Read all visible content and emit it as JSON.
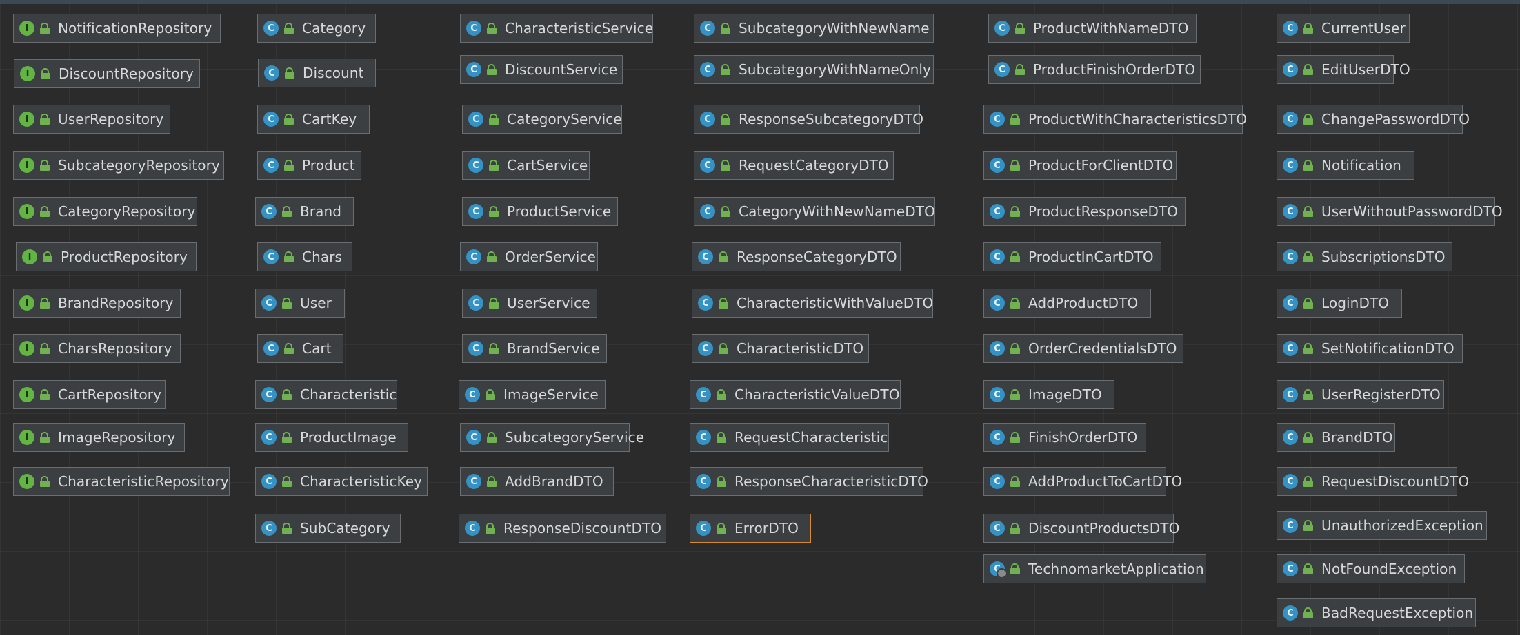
{
  "kind_letters": {
    "interface": "I",
    "class": "C"
  },
  "columns": [
    {
      "nodes": [
        {
          "label": "NotificationRepository",
          "kind": "interface"
        },
        {
          "label": "DiscountRepository",
          "kind": "interface"
        },
        {
          "label": "UserRepository",
          "kind": "interface"
        },
        {
          "label": "SubcategoryRepository",
          "kind": "interface"
        },
        {
          "label": "CategoryRepository",
          "kind": "interface"
        },
        {
          "label": "ProductRepository",
          "kind": "interface"
        },
        {
          "label": "BrandRepository",
          "kind": "interface"
        },
        {
          "label": "CharsRepository",
          "kind": "interface"
        },
        {
          "label": "CartRepository",
          "kind": "interface"
        },
        {
          "label": "ImageRepository",
          "kind": "interface"
        },
        {
          "label": "CharacteristicRepository",
          "kind": "interface"
        }
      ]
    },
    {
      "nodes": [
        {
          "label": "Category",
          "kind": "class"
        },
        {
          "label": "Discount",
          "kind": "class"
        },
        {
          "label": "CartKey",
          "kind": "class"
        },
        {
          "label": "Product",
          "kind": "class"
        },
        {
          "label": "Brand",
          "kind": "class"
        },
        {
          "label": "Chars",
          "kind": "class"
        },
        {
          "label": "User",
          "kind": "class"
        },
        {
          "label": "Cart",
          "kind": "class"
        },
        {
          "label": "Characteristic",
          "kind": "class"
        },
        {
          "label": "ProductImage",
          "kind": "class"
        },
        {
          "label": "CharacteristicKey",
          "kind": "class"
        },
        {
          "label": "SubCategory",
          "kind": "class"
        }
      ]
    },
    {
      "nodes": [
        {
          "label": "CharacteristicService",
          "kind": "class"
        },
        {
          "label": "DiscountService",
          "kind": "class"
        },
        {
          "label": "CategoryService",
          "kind": "class"
        },
        {
          "label": "CartService",
          "kind": "class"
        },
        {
          "label": "ProductService",
          "kind": "class"
        },
        {
          "label": "OrderService",
          "kind": "class"
        },
        {
          "label": "UserService",
          "kind": "class"
        },
        {
          "label": "BrandService",
          "kind": "class"
        },
        {
          "label": "ImageService",
          "kind": "class"
        },
        {
          "label": "SubcategoryService",
          "kind": "class"
        },
        {
          "label": "AddBrandDTO",
          "kind": "class"
        },
        {
          "label": "ResponseDiscountDTO",
          "kind": "class"
        }
      ]
    },
    {
      "nodes": [
        {
          "label": "SubcategoryWithNewName",
          "kind": "class"
        },
        {
          "label": "SubcategoryWithNameOnly",
          "kind": "class"
        },
        {
          "label": "ResponseSubcategoryDTO",
          "kind": "class"
        },
        {
          "label": "RequestCategoryDTO",
          "kind": "class"
        },
        {
          "label": "CategoryWithNewNameDTO",
          "kind": "class"
        },
        {
          "label": "ResponseCategoryDTO",
          "kind": "class"
        },
        {
          "label": "CharacteristicWithValueDTO",
          "kind": "class"
        },
        {
          "label": "CharacteristicDTO",
          "kind": "class"
        },
        {
          "label": "CharacteristicValueDTO",
          "kind": "class"
        },
        {
          "label": "RequestCharacteristic",
          "kind": "class"
        },
        {
          "label": "ResponseCharacteristicDTO",
          "kind": "class"
        },
        {
          "label": "ErrorDTO",
          "kind": "class",
          "selected": true
        }
      ]
    },
    {
      "nodes": [
        {
          "label": "ProductWithNameDTO",
          "kind": "class"
        },
        {
          "label": "ProductFinishOrderDTO",
          "kind": "class"
        },
        {
          "label": "ProductWithCharacteristicsDTO",
          "kind": "class"
        },
        {
          "label": "ProductForClientDTO",
          "kind": "class"
        },
        {
          "label": "ProductResponseDTO",
          "kind": "class"
        },
        {
          "label": "ProductInCartDTO",
          "kind": "class"
        },
        {
          "label": "AddProductDTO",
          "kind": "class"
        },
        {
          "label": "OrderCredentialsDTO",
          "kind": "class"
        },
        {
          "label": "ImageDTO",
          "kind": "class"
        },
        {
          "label": "FinishOrderDTO",
          "kind": "class"
        },
        {
          "label": "AddProductToCartDTO",
          "kind": "class"
        },
        {
          "label": "DiscountProductsDTO",
          "kind": "class"
        },
        {
          "label": "TechnomarketApplication",
          "kind": "app"
        }
      ]
    },
    {
      "nodes": [
        {
          "label": "CurrentUser",
          "kind": "class"
        },
        {
          "label": "EditUserDTO",
          "kind": "class"
        },
        {
          "label": "ChangePasswordDTO",
          "kind": "class"
        },
        {
          "label": "Notification",
          "kind": "class"
        },
        {
          "label": "UserWithoutPasswordDTO",
          "kind": "class"
        },
        {
          "label": "SubscriptionsDTO",
          "kind": "class"
        },
        {
          "label": "LoginDTO",
          "kind": "class"
        },
        {
          "label": "SetNotificationDTO",
          "kind": "class"
        },
        {
          "label": "UserRegisterDTO",
          "kind": "class"
        },
        {
          "label": "BrandDTO",
          "kind": "class"
        },
        {
          "label": "RequestDiscountDTO",
          "kind": "class"
        },
        {
          "label": "UnauthorizedException",
          "kind": "class"
        },
        {
          "label": "NotFoundException",
          "kind": "class"
        },
        {
          "label": "BadRequestException",
          "kind": "class"
        }
      ]
    }
  ]
}
